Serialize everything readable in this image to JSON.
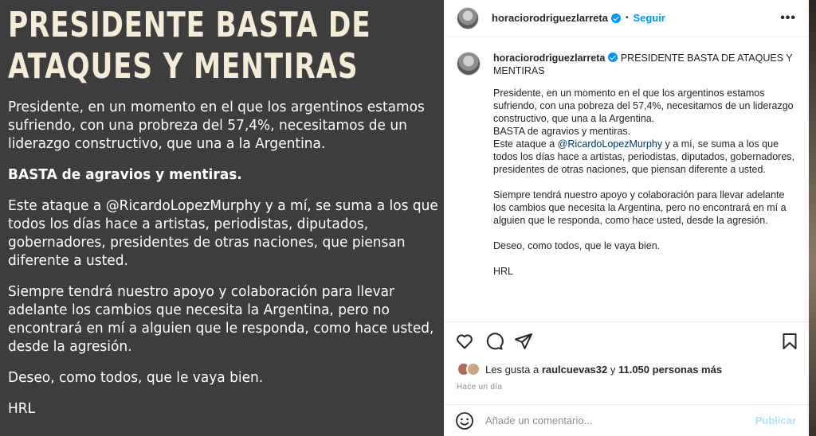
{
  "image": {
    "headline_1": "PRESIDENTE BASTA DE",
    "headline_2": "ATAQUES Y MENTIRAS",
    "paragraphs": [
      "Presidente, en un momento en el que los argentinos estamos sufriendo, con una probreza del 57,4%, necesitamos de un liderazgo constructivo, que una a la Argentina.",
      "BASTA de agravios y mentiras.",
      "Este ataque a @RicardoLopezMurphy y a mí, se suma a los que todos los días hace a artistas, periodistas, diputados, gobernadores, presidentes de otras naciones, que piensan diferente a usted.",
      "Siempre tendrá nuestro apoyo y colaboración para llevar adelante los cambios que necesita la Argentina, pero no encontrará en mí a alguien que le responda, como hace usted, desde la agresión.",
      "Deseo, como todos, que le vaya bien.",
      "HRL"
    ]
  },
  "header": {
    "username": "horaciorodriguezlarreta",
    "separator": "•",
    "follow_label": "Seguir",
    "more_label": "•••"
  },
  "caption": {
    "username": "horaciorodriguezlarreta",
    "title": "PRESIDENTE BASTA DE ATAQUES Y MENTIRAS",
    "p1": "Presidente, en un momento en el que los argentinos estamos sufriendo, con una pobreza del 57,4%, necesitamos de un liderazgo constructivo, que una a la Argentina.",
    "p2": "BASTA de agravios y mentiras.",
    "p3_pre": "Este ataque a ",
    "p3_mention": "@RicardoLopezMurphy",
    "p3_post": " y a mí, se suma a los que todos los días hace a artistas, periodistas, diputados, gobernadores, presidentes de otras naciones, que piensan diferente a usted.",
    "p4": "Siempre tendrá nuestro apoyo y colaboración para llevar adelante los cambios que necesita la Argentina, pero no encontrará en mí a alguien que le responda, como hace usted, desde la agresión.",
    "p5": "Deseo, como todos, que le vaya bien.",
    "p6": "HRL"
  },
  "likes": {
    "prefix": "Les gusta a ",
    "user": "raulcuevas32",
    "middle": " y ",
    "count": "11.050 personas más"
  },
  "time_ago": "Hace un día",
  "comment_input": {
    "placeholder": "Añade un comentario...",
    "publish_label": "Publicar"
  },
  "icons": {
    "like": "heart-icon",
    "comment": "comment-icon",
    "share": "send-icon",
    "save": "bookmark-icon",
    "emoji": "emoji-icon"
  },
  "colors": {
    "accent": "#0095f6",
    "image_bg": "#3d3d3d",
    "headline": "#f4ecd9"
  }
}
